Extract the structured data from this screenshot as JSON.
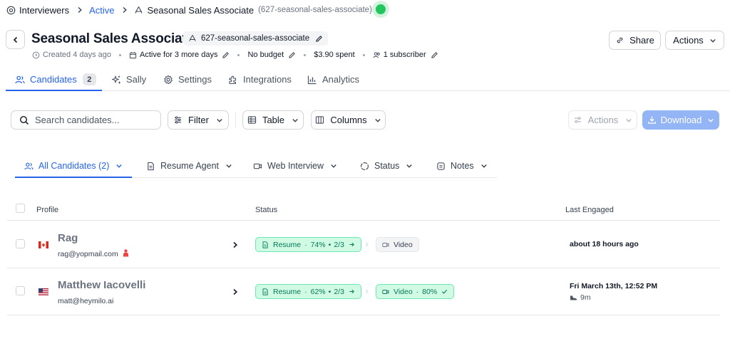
{
  "breadcrumb": {
    "root": "Interviewers",
    "status": "Active",
    "current": "Seasonal Sales Associate",
    "slug": "(627-seasonal-sales-associate)"
  },
  "header": {
    "title": "Seasonal Sales Associate",
    "slug": "627-seasonal-sales-associate",
    "meta": {
      "created": "Created 4 days ago",
      "active": "Active for 3 more days",
      "budget": "No budget",
      "spent": "$3.90 spent",
      "subscribers": "1 subscriber"
    },
    "share_label": "Share",
    "actions_label": "Actions"
  },
  "tabs": [
    {
      "label": "Candidates",
      "count": "2",
      "icon": "users-icon"
    },
    {
      "label": "Sally",
      "icon": "sparkles-icon"
    },
    {
      "label": "Settings",
      "icon": "gear-icon"
    },
    {
      "label": "Integrations",
      "icon": "puzzle-icon"
    },
    {
      "label": "Analytics",
      "icon": "bar-chart-icon"
    }
  ],
  "toolbar": {
    "search_placeholder": "Search candidates...",
    "filter_label": "Filter",
    "view_label": "Table",
    "columns_label": "Columns",
    "actions_label": "Actions",
    "download_label": "Download"
  },
  "subtabs": [
    {
      "label": "All Candidates (2)",
      "icon": "users-icon"
    },
    {
      "label": "Resume Agent",
      "icon": "document-icon"
    },
    {
      "label": "Web Interview",
      "icon": "video-icon"
    },
    {
      "label": "Status",
      "icon": "circle-dashed-icon"
    },
    {
      "label": "Notes",
      "icon": "note-icon"
    }
  ],
  "table": {
    "headers": {
      "profile": "Profile",
      "status": "Status",
      "last_engaged": "Last Engaged"
    },
    "rows": [
      {
        "name": "Rag",
        "email": "rag@yopmail.com",
        "flag": "canada-flag",
        "resume_status": "Resume",
        "resume_score": "74%",
        "resume_progress": "2/3",
        "video_status": "Video",
        "last_engaged": "about 18 hours ago"
      },
      {
        "name": "Matthew Iacovelli",
        "email": "matt@heymilo.ai",
        "flag": "usa-flag",
        "resume_status": "Resume",
        "resume_score": "62%",
        "resume_progress": "2/3",
        "video_status": "Video",
        "video_score": "80%",
        "last_engaged": "Fri March 13th, 12:52 PM",
        "duration": "9m"
      }
    ]
  },
  "colors": {
    "accent": "#2563eb",
    "success": "#047857",
    "online": "#22c55e"
  }
}
